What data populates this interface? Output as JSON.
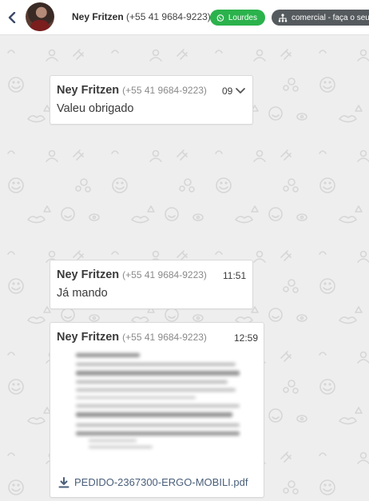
{
  "header": {
    "contact_name": "Ney Fritzen",
    "contact_phone": "(+55 41 9684-9223)",
    "agent_tag": "Lourdes",
    "department_tag": "comercial - faça o seu"
  },
  "messages": [
    {
      "sender": "Ney Fritzen",
      "phone": "(+55 41 9684-9223)",
      "time": "09",
      "text": "Valeu obrigado"
    },
    {
      "sender": "Ney Fritzen",
      "phone": "(+55 41 9684-9223)",
      "time": "11:51",
      "text": "Já mando"
    },
    {
      "sender": "Ney Fritzen",
      "phone": "(+55 41 9684-9223)",
      "time": "12:59",
      "attachment": "PEDIDO-2367300-ERGO-MOBILI.pdf"
    }
  ],
  "colors": {
    "accent_green": "#2bb24c",
    "tag_dark": "#555a5e",
    "link": "#4a5f7a",
    "chat_background": "#eeeeee"
  },
  "icons": {
    "back": "chevron-left-icon",
    "agent_tag": "whatsapp-icon",
    "department_tag": "hierarchy-icon",
    "message_menu": "chevron-down-icon",
    "attachment": "download-icon"
  }
}
